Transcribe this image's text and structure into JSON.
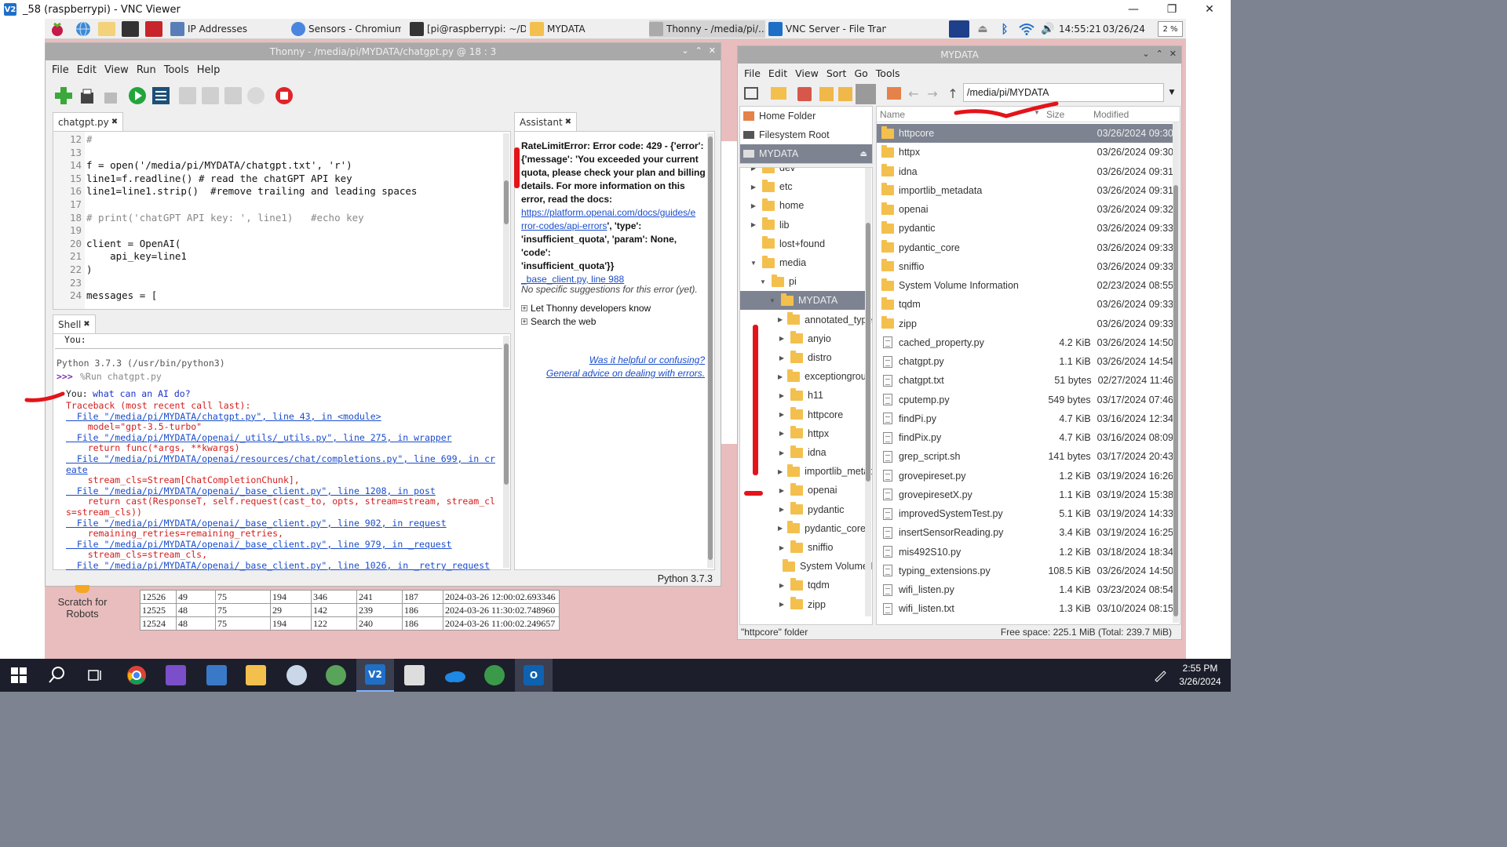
{
  "vnc": {
    "title": "_58 (raspberrypi) - VNC Viewer"
  },
  "pi_panel": {
    "tasks": [
      "IP Addresses",
      "Sensors - Chromium",
      "[pi@raspberrypi: ~/D...",
      "MYDATA",
      "Thonny - /media/pi/...",
      "VNC Server - File Tran..."
    ],
    "clock": "14:55:21",
    "date": "03/26/24",
    "cpu": "2 %"
  },
  "thonny": {
    "title": "Thonny - /media/pi/MYDATA/chatgpt.py @ 18 : 3",
    "menu": [
      "File",
      "Edit",
      "View",
      "Run",
      "Tools",
      "Help"
    ],
    "editor_tab": "chatgpt.py",
    "code": [
      {
        "n": "12",
        "t": "#"
      },
      {
        "n": "13",
        "t": ""
      },
      {
        "n": "14",
        "t": "f = open('/media/pi/MYDATA/chatgpt.txt', 'r')"
      },
      {
        "n": "15",
        "t": "line1=f.readline() # read the chatGPT API key"
      },
      {
        "n": "16",
        "t": "line1=line1.strip()  #remove trailing and leading spaces"
      },
      {
        "n": "17",
        "t": ""
      },
      {
        "n": "18",
        "t": "# print('chatGPT API key: ', line1)   #echo key"
      },
      {
        "n": "19",
        "t": ""
      },
      {
        "n": "20",
        "t": "client = OpenAI("
      },
      {
        "n": "21",
        "t": "    api_key=line1"
      },
      {
        "n": "22",
        "t": ")"
      },
      {
        "n": "23",
        "t": ""
      },
      {
        "n": "24",
        "t": "messages = ["
      }
    ],
    "shell_tab": "Shell",
    "shell": {
      "top": "You:",
      "python": "Python 3.7.3 (/usr/bin/python3)",
      "prompt": ">>> ",
      "run": "%Run chatgpt.py",
      "you_label": "You: ",
      "you_q": "what can an AI do?",
      "traceback": [
        {
          "k": "red",
          "t": "Traceback (most recent call last):"
        },
        {
          "k": "link",
          "t": "  File \"/media/pi/MYDATA/chatgpt.py\", line 43, in <module>"
        },
        {
          "k": "red",
          "t": "    model=\"gpt-3.5-turbo\""
        },
        {
          "k": "link",
          "t": "  File \"/media/pi/MYDATA/openai/_utils/_utils.py\", line 275, in wrapper"
        },
        {
          "k": "red",
          "t": "    return func(*args, **kwargs)"
        },
        {
          "k": "link",
          "t": "  File \"/media/pi/MYDATA/openai/resources/chat/completions.py\", line 699, in cr"
        },
        {
          "k": "link",
          "t": "eate"
        },
        {
          "k": "red",
          "t": "    stream_cls=Stream[ChatCompletionChunk],"
        },
        {
          "k": "link",
          "t": "  File \"/media/pi/MYDATA/openai/_base_client.py\", line 1208, in post"
        },
        {
          "k": "red",
          "t": "    return cast(ResponseT, self.request(cast_to, opts, stream=stream, stream_cl"
        },
        {
          "k": "red",
          "t": "s=stream_cls))"
        },
        {
          "k": "link",
          "t": "  File \"/media/pi/MYDATA/openai/_base_client.py\", line 902, in request"
        },
        {
          "k": "red",
          "t": "    remaining_retries=remaining_retries,"
        },
        {
          "k": "link",
          "t": "  File \"/media/pi/MYDATA/openai/_base_client.py\", line 979, in _request"
        },
        {
          "k": "red",
          "t": "    stream_cls=stream_cls,"
        },
        {
          "k": "link",
          "t": "  File \"/media/pi/MYDATA/openai/_base_client.py\", line 1026, in _retry_request"
        }
      ]
    },
    "assistant_tab": "Assistant",
    "assistant": {
      "error_lines": [
        "RateLimitError: Error code: 429 - {'error':",
        "{'message': 'You exceeded your current",
        "quota, please check your plan and billing",
        "details. For more information on this",
        "error, read the docs:"
      ],
      "docs_link_1": "https://platform.openai.com/docs/guides/e",
      "docs_link_2": "rror-codes/api-errors",
      "after_link": "', 'type':",
      "quota_line_1": "'insufficient_quota', 'param': None, 'code':",
      "quota_line_2": "'insufficient_quota'}}",
      "source_link": "_base_client.py, line 988",
      "no_suggestions": "No specific suggestions for this error (yet).",
      "option_1": "Let Thonny developers know",
      "option_2": "Search the web",
      "helpful": "Was it helpful or confusing?",
      "advice": "General advice on dealing with errors."
    },
    "status": "Python 3.7.3"
  },
  "scratch": {
    "label_1": "Scratch for",
    "label_2": "Robots"
  },
  "sensor_table": [
    [
      "12526",
      "49",
      "75",
      "194",
      "346",
      "241",
      "187",
      "2024-03-26 12:00:02.693346"
    ],
    [
      "12525",
      "48",
      "75",
      "29",
      "142",
      "239",
      "186",
      "2024-03-26 11:30:02.748960"
    ],
    [
      "12524",
      "48",
      "75",
      "194",
      "122",
      "240",
      "186",
      "2024-03-26 11:00:02.249657"
    ]
  ],
  "file_manager": {
    "title": "MYDATA",
    "menu": [
      "File",
      "Edit",
      "View",
      "Sort",
      "Go",
      "Tools"
    ],
    "path": "/media/pi/MYDATA",
    "places": [
      "Home Folder",
      "Filesystem Root",
      "MYDATA"
    ],
    "tree": [
      {
        "label": "dev",
        "depth": 0,
        "exp": "▶"
      },
      {
        "label": "etc",
        "depth": 0,
        "exp": "▶"
      },
      {
        "label": "home",
        "depth": 0,
        "exp": "▶"
      },
      {
        "label": "lib",
        "depth": 0,
        "exp": "▶"
      },
      {
        "label": "lost+found",
        "depth": 0,
        "exp": ""
      },
      {
        "label": "media",
        "depth": 0,
        "exp": "▼"
      },
      {
        "label": "pi",
        "depth": 1,
        "exp": "▼"
      },
      {
        "label": "MYDATA",
        "depth": 2,
        "exp": "▼",
        "sel": true
      },
      {
        "label": "annotated_types",
        "depth": 3,
        "exp": "▶"
      },
      {
        "label": "anyio",
        "depth": 3,
        "exp": "▶"
      },
      {
        "label": "distro",
        "depth": 3,
        "exp": "▶"
      },
      {
        "label": "exceptiongroup",
        "depth": 3,
        "exp": "▶"
      },
      {
        "label": "h11",
        "depth": 3,
        "exp": "▶"
      },
      {
        "label": "httpcore",
        "depth": 3,
        "exp": "▶"
      },
      {
        "label": "httpx",
        "depth": 3,
        "exp": "▶"
      },
      {
        "label": "idna",
        "depth": 3,
        "exp": "▶"
      },
      {
        "label": "importlib_metadata",
        "depth": 3,
        "exp": "▶"
      },
      {
        "label": "openai",
        "depth": 3,
        "exp": "▶"
      },
      {
        "label": "pydantic",
        "depth": 3,
        "exp": "▶"
      },
      {
        "label": "pydantic_core",
        "depth": 3,
        "exp": "▶"
      },
      {
        "label": "sniffio",
        "depth": 3,
        "exp": "▶"
      },
      {
        "label": "System Volume Information",
        "depth": 3,
        "exp": ""
      },
      {
        "label": "tqdm",
        "depth": 3,
        "exp": "▶"
      },
      {
        "label": "zipp",
        "depth": 3,
        "exp": "▶"
      }
    ],
    "columns": {
      "name": "Name",
      "size": "Size",
      "modified": "Modified"
    },
    "files": [
      {
        "name": "httpcore",
        "size": "",
        "mod": "03/26/2024 09:30",
        "type": "dir",
        "sel": true
      },
      {
        "name": "httpx",
        "size": "",
        "mod": "03/26/2024 09:30",
        "type": "dir"
      },
      {
        "name": "idna",
        "size": "",
        "mod": "03/26/2024 09:31",
        "type": "dir"
      },
      {
        "name": "importlib_metadata",
        "size": "",
        "mod": "03/26/2024 09:31",
        "type": "dir"
      },
      {
        "name": "openai",
        "size": "",
        "mod": "03/26/2024 09:32",
        "type": "dir"
      },
      {
        "name": "pydantic",
        "size": "",
        "mod": "03/26/2024 09:33",
        "type": "dir"
      },
      {
        "name": "pydantic_core",
        "size": "",
        "mod": "03/26/2024 09:33",
        "type": "dir"
      },
      {
        "name": "sniffio",
        "size": "",
        "mod": "03/26/2024 09:33",
        "type": "dir"
      },
      {
        "name": "System Volume Information",
        "size": "",
        "mod": "02/23/2024 08:55",
        "type": "dir"
      },
      {
        "name": "tqdm",
        "size": "",
        "mod": "03/26/2024 09:33",
        "type": "dir"
      },
      {
        "name": "zipp",
        "size": "",
        "mod": "03/26/2024 09:33",
        "type": "dir"
      },
      {
        "name": "cached_property.py",
        "size": "4.2 KiB",
        "mod": "03/26/2024 14:50",
        "type": "file"
      },
      {
        "name": "chatgpt.py",
        "size": "1.1 KiB",
        "mod": "03/26/2024 14:54",
        "type": "file"
      },
      {
        "name": "chatgpt.txt",
        "size": "51 bytes",
        "mod": "02/27/2024 11:46",
        "type": "file"
      },
      {
        "name": "cputemp.py",
        "size": "549 bytes",
        "mod": "03/17/2024 07:46",
        "type": "file"
      },
      {
        "name": "findPi.py",
        "size": "4.7 KiB",
        "mod": "03/16/2024 12:34",
        "type": "file"
      },
      {
        "name": "findPix.py",
        "size": "4.7 KiB",
        "mod": "03/16/2024 08:09",
        "type": "file"
      },
      {
        "name": "grep_script.sh",
        "size": "141 bytes",
        "mod": "03/17/2024 20:43",
        "type": "file"
      },
      {
        "name": "grovepireset.py",
        "size": "1.2 KiB",
        "mod": "03/19/2024 16:26",
        "type": "file"
      },
      {
        "name": "grovepiresetX.py",
        "size": "1.1 KiB",
        "mod": "03/19/2024 15:38",
        "type": "file"
      },
      {
        "name": "improvedSystemTest.py",
        "size": "5.1 KiB",
        "mod": "03/19/2024 14:33",
        "type": "file"
      },
      {
        "name": "insertSensorReading.py",
        "size": "3.4 KiB",
        "mod": "03/19/2024 16:25",
        "type": "file"
      },
      {
        "name": "mis492S10.py",
        "size": "1.2 KiB",
        "mod": "03/18/2024 18:34",
        "type": "file"
      },
      {
        "name": "typing_extensions.py",
        "size": "108.5 KiB",
        "mod": "03/26/2024 14:50",
        "type": "file"
      },
      {
        "name": "wifi_listen.py",
        "size": "1.4 KiB",
        "mod": "03/23/2024 08:54",
        "type": "file"
      },
      {
        "name": "wifi_listen.txt",
        "size": "1.3 KiB",
        "mod": "03/10/2024 08:15",
        "type": "file"
      }
    ],
    "status_left": "\"httpcore\" folder",
    "status_right": "Free space: 225.1 MiB (Total: 239.7 MiB)"
  },
  "windows": {
    "time": "2:55 PM",
    "date": "3/26/2024"
  },
  "colors": {
    "accent": "#e3141a",
    "selection": "#7d8391",
    "folder": "#f3c04e",
    "taskbar": "#1c1f2b"
  }
}
